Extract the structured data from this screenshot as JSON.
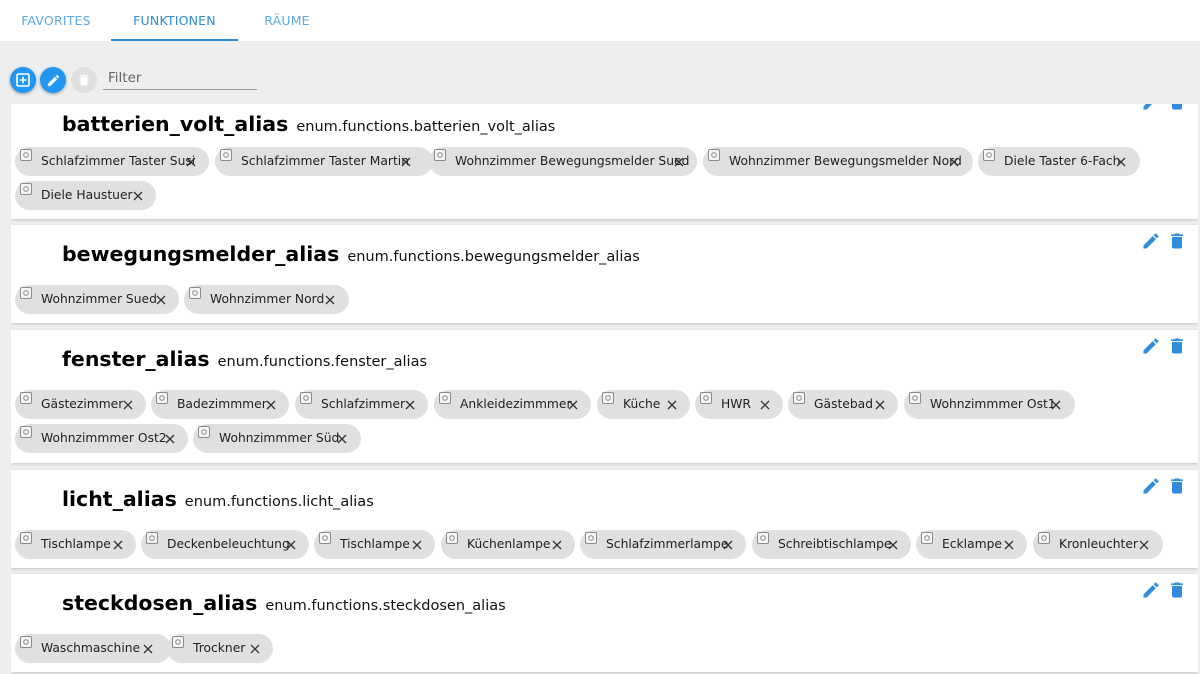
{
  "tabs": [
    {
      "label": "FAVORITES",
      "active": false
    },
    {
      "label": "FUNKTIONEN",
      "active": true
    },
    {
      "label": "RÄUME",
      "active": false
    }
  ],
  "toolbar": {
    "filter_placeholder": "Filter",
    "filter_value": ""
  },
  "colors": {
    "accent": "#2196f3",
    "tab_text": "#5aa9e6",
    "chip_bg": "#e0e0e0",
    "icon_blue": "#2f8ddb"
  },
  "icons": {
    "add": "add-box-icon",
    "edit": "pencil-icon",
    "delete": "trash-icon",
    "chip": "state-object-icon",
    "chip_remove": "close-icon"
  },
  "functions": [
    {
      "name": "batterien_volt_alias",
      "id": "enum.functions.batterien_volt_alias",
      "members": [
        "Schlafzimmer Taster Susi",
        "Schlafzimmer Taster Martin",
        "Wohnzimmer Bewegungsmelder Sued",
        "Wohnzimmer Bewegungsmelder Nord",
        "Diele Taster 6-Fach",
        "Diele Haustuer"
      ]
    },
    {
      "name": "bewegungsmelder_alias",
      "id": "enum.functions.bewegungsmelder_alias",
      "members": [
        "Wohnzimmer Sued",
        "Wohnzimmer Nord"
      ]
    },
    {
      "name": "fenster_alias",
      "id": "enum.functions.fenster_alias",
      "members": [
        "Gästezimmer",
        "Badezimmmer",
        "Schlafzimmer",
        "Ankleidezimmmer",
        "Küche",
        "HWR",
        "Gästebad",
        "Wohnzimmmer Ost1",
        "Wohnzimmmer Ost2",
        "Wohnzimmmer Süd"
      ]
    },
    {
      "name": "licht_alias",
      "id": "enum.functions.licht_alias",
      "members": [
        "Tischlampe",
        "Deckenbeleuchtung",
        "Tischlampe",
        "Küchenlampe",
        "Schlafzimmerlampe",
        "Schreibtischlampe",
        "Ecklampe",
        "Kronleuchter"
      ]
    },
    {
      "name": "steckdosen_alias",
      "id": "enum.functions.steckdosen_alias",
      "members": [
        "Waschmaschine",
        "Trockner"
      ]
    }
  ]
}
